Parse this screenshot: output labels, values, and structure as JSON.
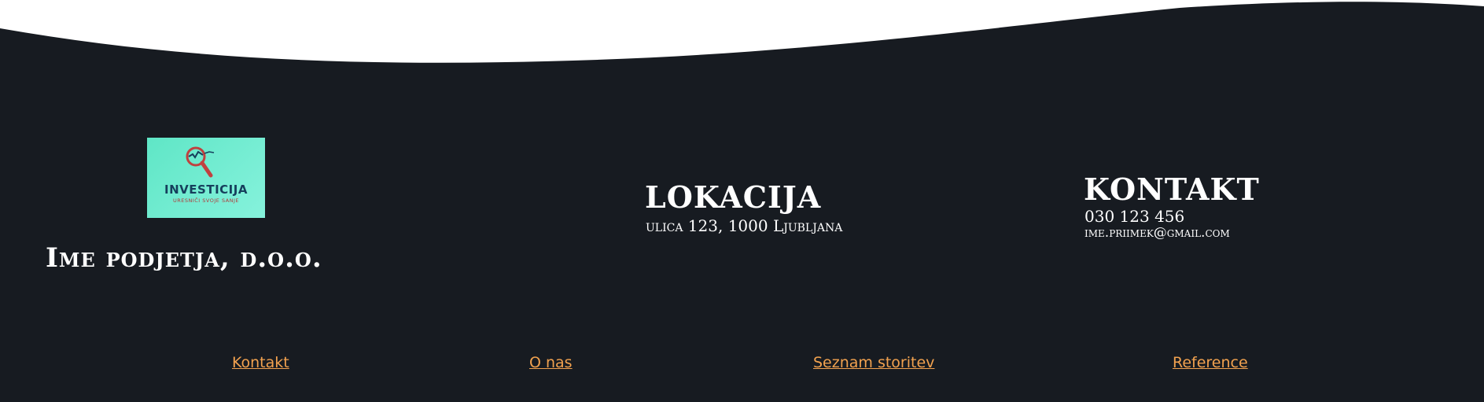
{
  "colors": {
    "footer_bg": "#171b21",
    "link": "#f2a24f",
    "logo_bg": "#6ff0d4"
  },
  "logo": {
    "title": "INVESTICIJA",
    "subtitle": "URESNIČI SVOJE SANJE",
    "icon": "magnifier-icon"
  },
  "company": {
    "name": "Ime podjetja, d.o.o."
  },
  "location": {
    "title": "LOKACIJA",
    "address": "ulica 123, 1000 Ljubljana"
  },
  "contact": {
    "title": "KONTAKT",
    "phone": "030 123 456",
    "email": "ime.priimek@gmail.com"
  },
  "nav": {
    "items": [
      {
        "label": "Kontakt"
      },
      {
        "label": "O nas"
      },
      {
        "label": "Seznam storitev"
      },
      {
        "label": "Reference"
      }
    ]
  }
}
